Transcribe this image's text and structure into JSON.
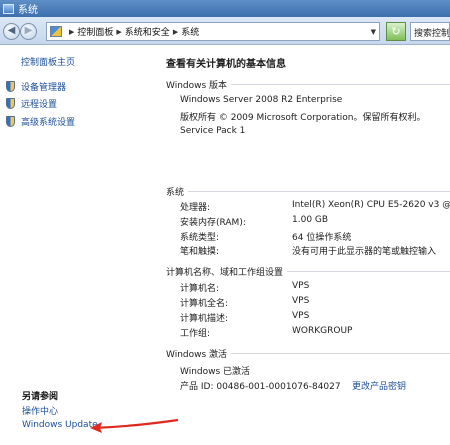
{
  "window": {
    "title": "系统"
  },
  "address": {
    "breadcrumbs": [
      "控制面板",
      "系统和安全",
      "系统"
    ],
    "search_placeholder": "搜索控制"
  },
  "sidebar": {
    "home": "控制面板主页",
    "items": [
      {
        "label": "设备管理器",
        "icon": "shield-icon"
      },
      {
        "label": "远程设置",
        "icon": "shield-icon"
      },
      {
        "label": "高级系统设置",
        "icon": "shield-icon"
      }
    ],
    "see_also": {
      "title": "另请参阅",
      "links": [
        "操作中心",
        "Windows Update"
      ]
    }
  },
  "main": {
    "heading": "查看有关计算机的基本信息",
    "edition": {
      "title": "Windows 版本",
      "name": "Windows Server 2008 R2 Enterprise",
      "copyright": "版权所有 © 2009 Microsoft Corporation。保留所有权利。",
      "service_pack": "Service Pack 1"
    },
    "system": {
      "title": "系统",
      "rows": [
        {
          "key": "处理器:",
          "value": "Intel(R) Xeon(R) CPU E5-2620 v3 @ 2."
        },
        {
          "key": "安装内存(RAM):",
          "value": "1.00 GB"
        },
        {
          "key": "系统类型:",
          "value": "64 位操作系统"
        },
        {
          "key": "笔和触摸:",
          "value": "没有可用于此显示器的笔或触控输入"
        }
      ]
    },
    "computer": {
      "title": "计算机名称、域和工作组设置",
      "rows": [
        {
          "key": "计算机名:",
          "value": "VPS"
        },
        {
          "key": "计算机全名:",
          "value": "VPS"
        },
        {
          "key": "计算机描述:",
          "value": "VPS"
        },
        {
          "key": "工作组:",
          "value": "WORKGROUP"
        }
      ]
    },
    "activation": {
      "title": "Windows 激活",
      "status": "Windows 已激活",
      "product_id": "产品 ID: 00486-001-0001076-84027",
      "change_key": "更改产品密钥"
    }
  },
  "annotation": {
    "arrow_color": "#e0281e"
  }
}
